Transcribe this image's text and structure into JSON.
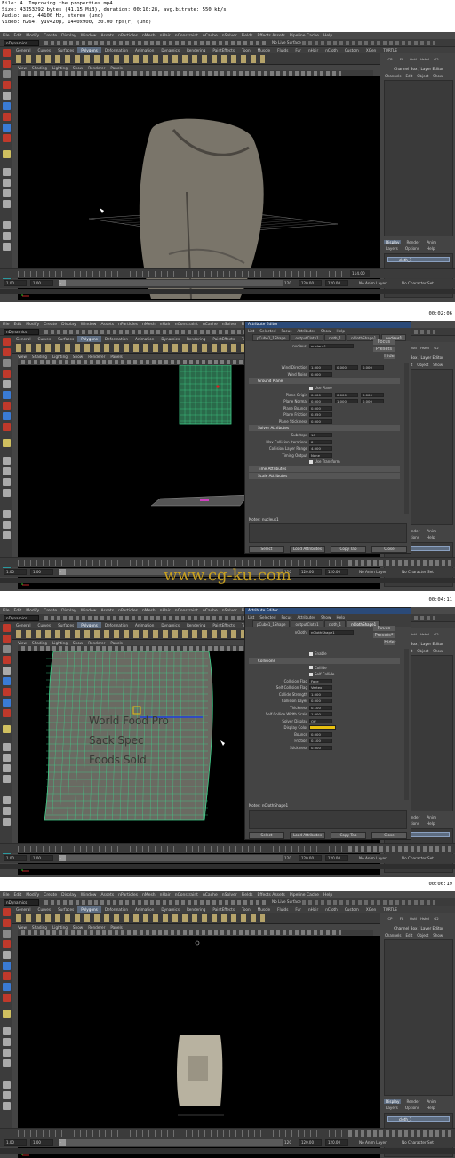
{
  "file_info": {
    "lines": [
      "File: 4. Improving the properties.mp4",
      "Size: 43153292 bytes (41.15 MiB), duration: 00:10:28, avg.bitrate: 550 kb/s",
      "Audio: aac, 44100 Hz, stereo (und)",
      "Video: h264, yuv420p, 1440x900, 30.00 fps(r) (und)"
    ]
  },
  "maya": {
    "menus": [
      "File",
      "Edit",
      "Modify",
      "Create",
      "Display",
      "Window",
      "Assets",
      "nParticles",
      "nMesh",
      "nHair",
      "nConstraint",
      "nCache",
      "nSolver",
      "Fields",
      "Effects Assets",
      "Pipeline Cache",
      "Help"
    ],
    "mode": "nDynamics",
    "live_surface": "No Live Surface",
    "shelf_tabs": [
      "General",
      "Curves",
      "Surfaces",
      "Polygons",
      "Deformation",
      "Animation",
      "Dynamics",
      "Rendering",
      "PaintEffects",
      "Toon",
      "Muscle",
      "Fluids",
      "Fur",
      "nHair",
      "nCloth",
      "Custom",
      "XGen",
      "TURTLE"
    ],
    "active_shelf_tab": "Polygons",
    "shelf_buttons": [
      "CP",
      "FL",
      "Outl",
      "Hshd",
      "G2"
    ],
    "viewport_menus": [
      "View",
      "Shading",
      "Lighting",
      "Show",
      "Renderer",
      "Panels"
    ],
    "channel_box": {
      "title": "Channel Box / Layer Editor",
      "menus": [
        "Channels",
        "Edit",
        "Object",
        "Show"
      ],
      "layer_tabs": [
        "Display",
        "Render",
        "Anim"
      ],
      "layer_menus": [
        "Layers",
        "Options",
        "Help"
      ],
      "layer_name": "cloth_1"
    },
    "timeline": {
      "ticks": [
        "1",
        "2",
        "4",
        "6",
        "8",
        "10",
        "12",
        "14",
        "16",
        "18",
        "20",
        "22",
        "24",
        "26",
        "28",
        "30",
        "32",
        "34",
        "36",
        "38",
        "40",
        "42",
        "44",
        "46",
        "48",
        "50",
        "52",
        "54",
        "56",
        "58",
        "60",
        "62",
        "64",
        "66",
        "68",
        "70",
        "72",
        "74",
        "76",
        "78",
        "80",
        "82",
        "84",
        "86",
        "88",
        "90",
        "92",
        "94",
        "96",
        "98",
        "100",
        "102",
        "104",
        "106",
        "108",
        "110",
        "112",
        "114",
        "116",
        "118",
        "120"
      ]
    },
    "range": {
      "start": "1.00",
      "start2": "1.00",
      "slider_start": "1",
      "slider_end": "120",
      "end": "120.00",
      "end2": "120.00",
      "anim_layer": "No Anim Layer",
      "char_set": "No Character Set"
    }
  },
  "frames": [
    {
      "current_frame": "114.00",
      "timestamp": "00:02:06"
    },
    {
      "current_frame": "",
      "timestamp": "00:04:11",
      "ae": {
        "title": "Attribute Editor",
        "menus": [
          "List",
          "Selected",
          "Focus",
          "Attributes",
          "Show",
          "Help"
        ],
        "tabs": [
          "pCube1_1Shape",
          "outputCloth1",
          "cloth_1",
          "nClothShape1",
          "nucleus1"
        ],
        "active_tab": "nucleus1",
        "node_label": "nucleus:",
        "node_value": "nucleus1",
        "side_buttons": [
          "Focus",
          "Presets",
          "Show",
          "Hide"
        ],
        "rows": [
          {
            "label": "Wind Direction",
            "v": [
              "1.000",
              "0.000",
              "0.000"
            ]
          },
          {
            "label": "Wind Noise",
            "v": [
              "0.000"
            ]
          }
        ],
        "sections": [
          {
            "title": "Ground Plane",
            "check": "Use Plane",
            "rows": [
              {
                "label": "Plane Origin",
                "v": [
                  "0.000",
                  "0.000",
                  "0.000"
                ]
              },
              {
                "label": "Plane Normal",
                "v": [
                  "0.000",
                  "1.000",
                  "0.000"
                ]
              },
              {
                "label": "Plane Bounce",
                "v": [
                  "0.000"
                ]
              },
              {
                "label": "Plane Friction",
                "v": [
                  "0.350"
                ]
              },
              {
                "label": "Plane Stickiness",
                "v": [
                  "0.000"
                ]
              }
            ]
          },
          {
            "title": "Solver Attributes",
            "rows": [
              {
                "label": "Substeps",
                "v": [
                  "10"
                ]
              },
              {
                "label": "Max Collision Iterations",
                "v": [
                  "8"
                ]
              },
              {
                "label": "Collision Layer Range",
                "v": [
                  "4.000"
                ]
              },
              {
                "label": "Timing Output",
                "v": [
                  "None"
                ]
              }
            ],
            "check": "Use Transform"
          },
          {
            "title": "Time Attributes"
          },
          {
            "title": "Scale Attributes"
          }
        ],
        "notes": "Notes: nucleus1",
        "buttons": [
          "Select",
          "Load Attributes",
          "Copy Tab",
          "Close"
        ]
      }
    },
    {
      "current_frame": "",
      "timestamp": "00:06:19",
      "ae": {
        "title": "Attribute Editor",
        "menus": [
          "List",
          "Selected",
          "Focus",
          "Attributes",
          "Show",
          "Help"
        ],
        "tabs": [
          "pCube1_1Shape",
          "outputCloth1",
          "cloth_1",
          "nClothShape1"
        ],
        "active_tab": "nClothShape1",
        "node_label": "nCloth:",
        "node_value": "nClothShape1",
        "side_buttons": [
          "Focus",
          "Presets*",
          "Show",
          "Hide"
        ],
        "enable": "Enable",
        "section": "Collisions",
        "checks": [
          "Collide",
          "Self Collide"
        ],
        "rows": [
          {
            "label": "Collision Flag",
            "v": [
              "Face"
            ]
          },
          {
            "label": "Self Collision Flag",
            "v": [
              "Vertex"
            ]
          },
          {
            "label": "Collide Strength",
            "v": [
              "1.000"
            ]
          },
          {
            "label": "Collision Layer",
            "v": [
              "0.000"
            ]
          },
          {
            "label": "Thickness",
            "v": [
              "0.100"
            ]
          },
          {
            "label": "Self Collide Width Scale",
            "v": [
              "1.000"
            ]
          },
          {
            "label": "Solver Display",
            "v": [
              "Off"
            ]
          },
          {
            "label": "Display Color",
            "v": [
              ""
            ]
          },
          {
            "label": "Bounce",
            "v": [
              "0.000"
            ]
          },
          {
            "label": "Friction",
            "v": [
              "0.100"
            ]
          },
          {
            "label": "Stickiness",
            "v": [
              "0.000"
            ]
          }
        ],
        "notes": "Notes: nClothShape1",
        "buttons": [
          "Select",
          "Load Attributes",
          "Copy Tab",
          "Close"
        ]
      }
    },
    {
      "current_frame": "",
      "timestamp": "00:08:31"
    }
  ],
  "watermark": "www.cg-ku.com",
  "bag_text": [
    "World Food Pro",
    "Sack Spec",
    "Foods Sold"
  ],
  "colors": {
    "accent_tab": "#5d6c80",
    "title_blue": "#2b4a78",
    "watermark": "#c8a020",
    "mesh_green": "#3fd08a",
    "display_yellow": "#e8c010"
  }
}
